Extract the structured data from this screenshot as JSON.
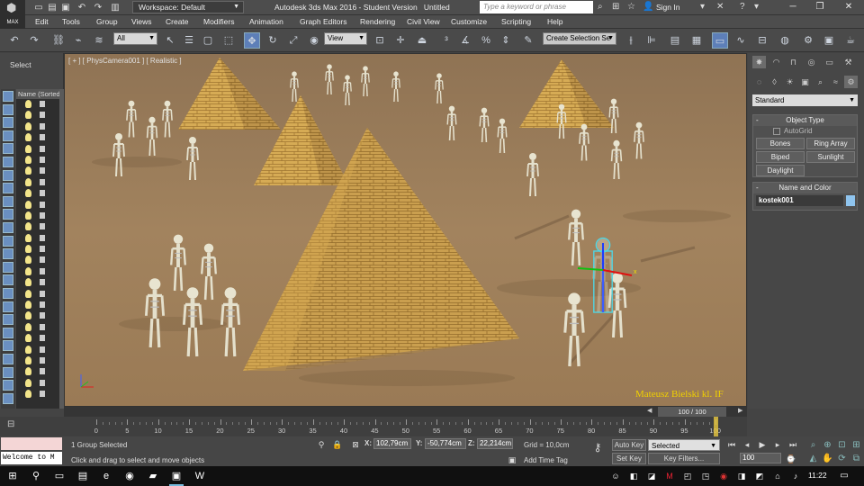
{
  "app": {
    "logo_text": "MAX",
    "window_title": "Autodesk 3ds Max 2016 - Student Version",
    "file_name": "Untitled",
    "workspace_label": "Workspace: Default",
    "search_placeholder": "Type a keyword or phrase",
    "sign_in": "Sign In"
  },
  "menu": [
    "Edit",
    "Tools",
    "Group",
    "Views",
    "Create",
    "Modifiers",
    "Animation",
    "Graph Editors",
    "Rendering",
    "Civil View",
    "Customize",
    "Scripting",
    "Help"
  ],
  "toolbar": {
    "filter_value": "All",
    "ref_coord_value": "View",
    "selection_set_placeholder": "Create Selection Se"
  },
  "scene_explorer": {
    "select_label": "Select",
    "column_header": "Name (Sorted",
    "row_count": 27
  },
  "viewport": {
    "label": "[ + ] [ PhysCamera001 ] [ Realistic ]",
    "watermark": "Mateusz Bielski  kl. IF"
  },
  "command_panel": {
    "category_value": "Standard",
    "object_type": {
      "title": "Object Type",
      "autogrid": "AutoGrid",
      "buttons": [
        "Bones",
        "Ring Array",
        "Biped",
        "Sunlight",
        "Daylight"
      ]
    },
    "name_and_color": {
      "title": "Name and Color",
      "name_value": "kostek001",
      "color": "#8fc4ee"
    }
  },
  "timeline": {
    "frame_display": "100 / 100",
    "ticks": [
      "0",
      "5",
      "10",
      "15",
      "20",
      "25",
      "30",
      "35",
      "40",
      "45",
      "50",
      "55",
      "60",
      "65",
      "70",
      "75",
      "80",
      "85",
      "90",
      "95",
      "100"
    ]
  },
  "status": {
    "selection_info": "1 Group Selected",
    "prompt": "Click and drag to select and move objects",
    "x_label": "X:",
    "x_value": "102,79cm",
    "y_label": "Y:",
    "y_value": "-50,774cm",
    "z_label": "Z:",
    "z_value": "22,214cm",
    "grid": "Grid = 10,0cm",
    "add_time_tag": "Add Time Tag",
    "auto_key": "Auto Key",
    "set_key": "Set Key",
    "key_mode_value": "Selected",
    "key_filters": "Key Filters...",
    "current_frame": "100",
    "maxscript_text": "Welcome to M"
  },
  "taskbar": {
    "clock": "11:22"
  },
  "colors": {
    "ui_background": "#474747",
    "sand": "#9b7e5c",
    "pyramid_light": "#d9b05a",
    "pyramid_dark": "#a8803c",
    "selection_highlight": "#5d7fb8",
    "watermark": "#f0d000"
  }
}
